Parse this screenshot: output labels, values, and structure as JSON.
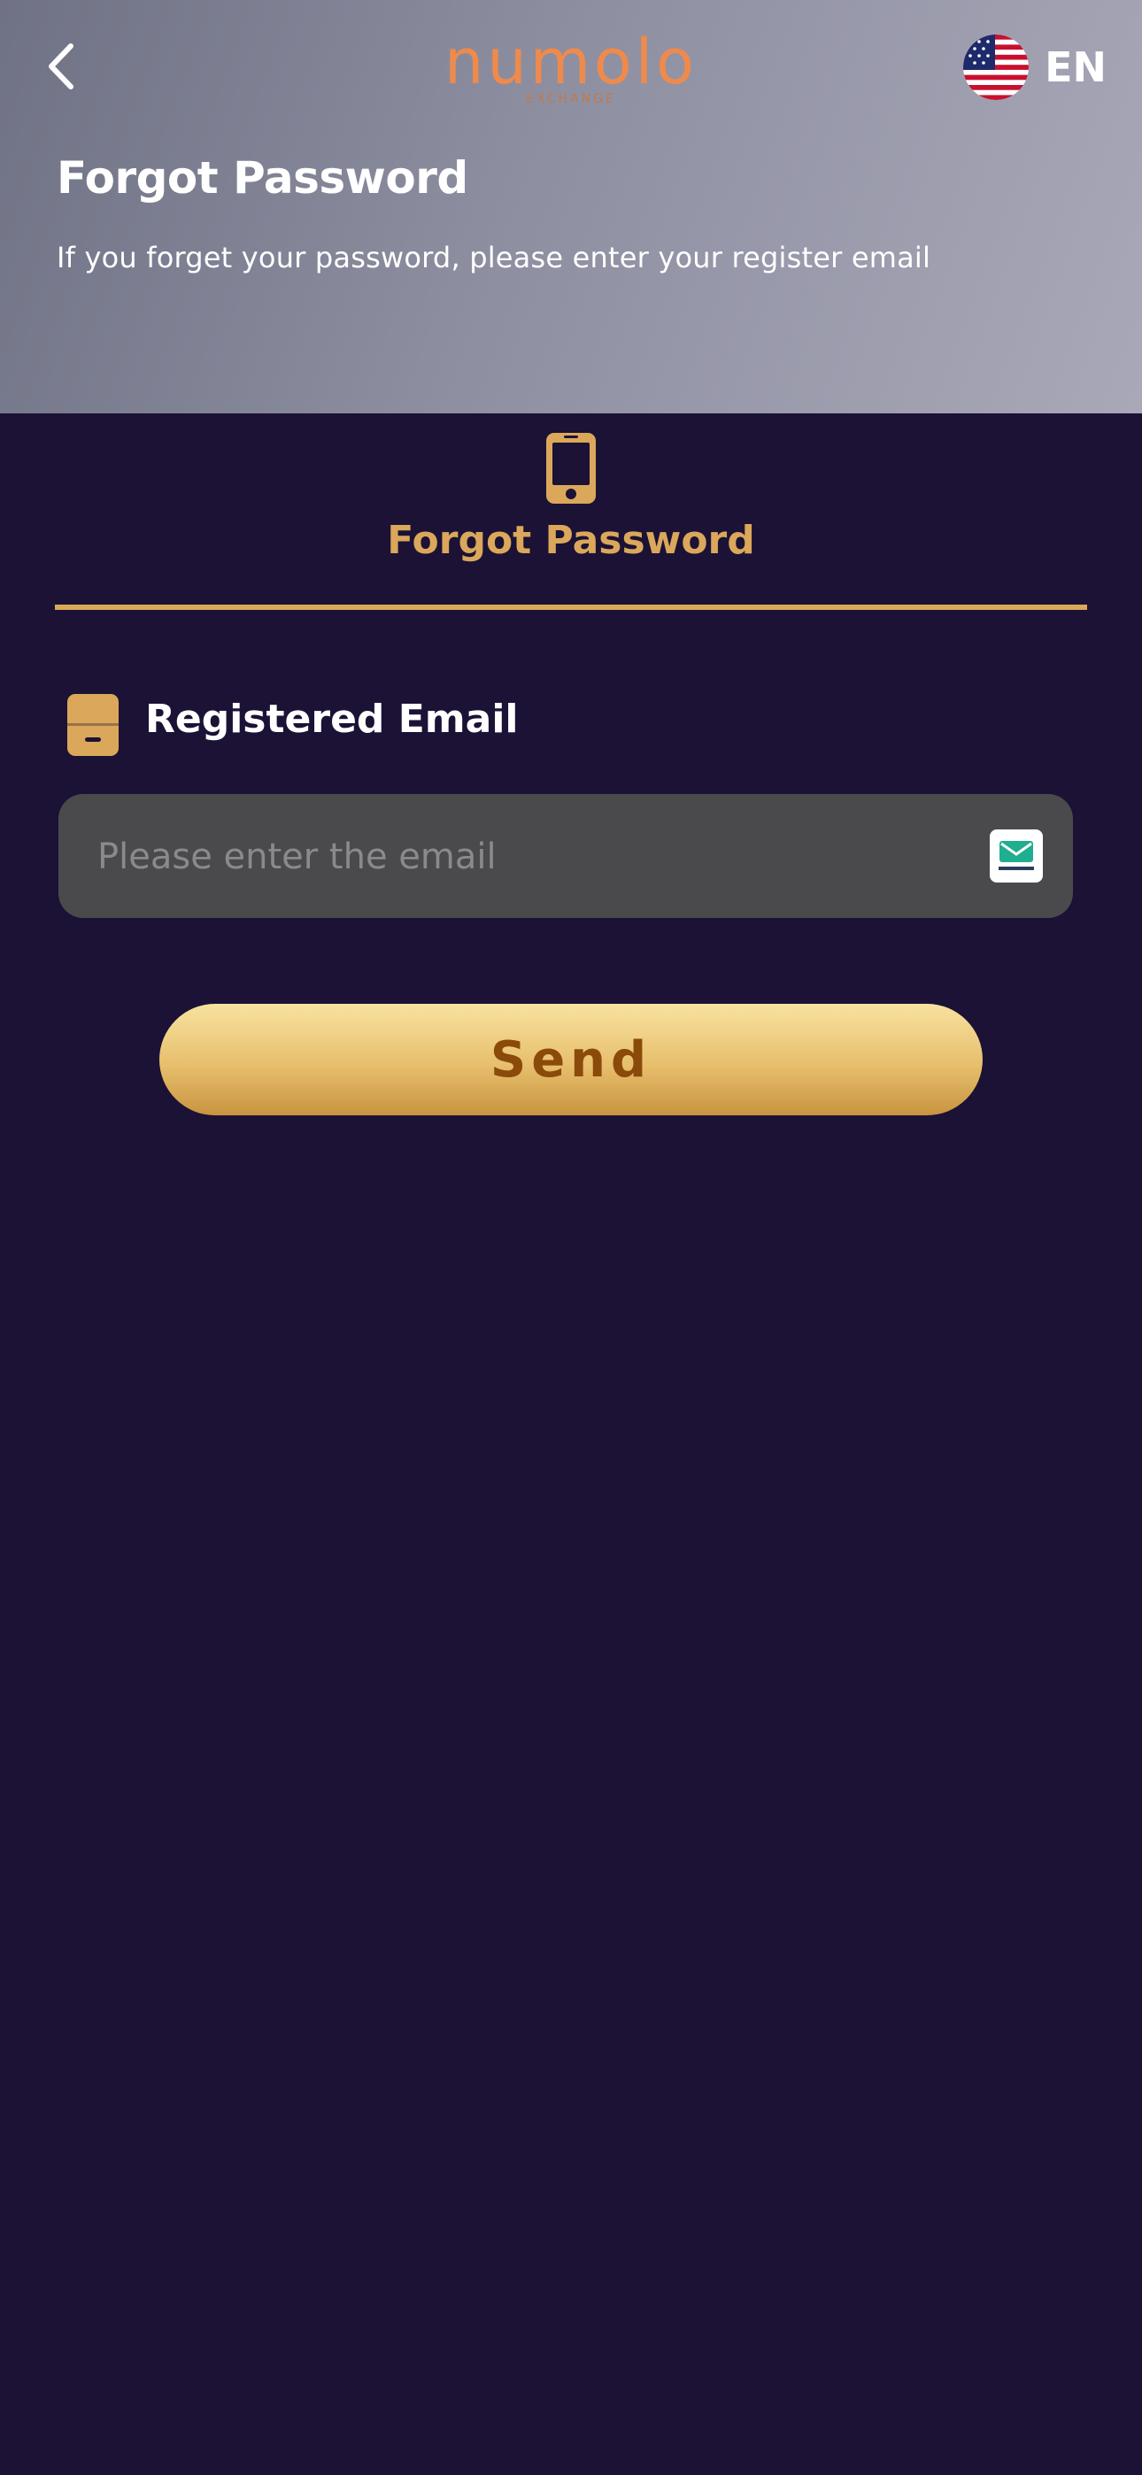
{
  "header": {
    "logo_text": "numolo",
    "logo_tagline": "EXCHANGE",
    "language_code": "EN",
    "title": "Forgot Password",
    "description": "If you forget your password, please enter your register email"
  },
  "tab": {
    "label": "Forgot Password",
    "icon": "smartphone-icon"
  },
  "form": {
    "email_label": "Registered Email",
    "email_placeholder": "Please enter the email",
    "email_value": "",
    "tempmail_icon": "tempmail-icon",
    "send_label": "Send"
  },
  "colors": {
    "background": "#1b1235",
    "accent_gold": "#dba75b",
    "logo_orange": "#f08a4b",
    "input_bg": "#4a4a4c",
    "send_text": "#8a4a0a"
  }
}
